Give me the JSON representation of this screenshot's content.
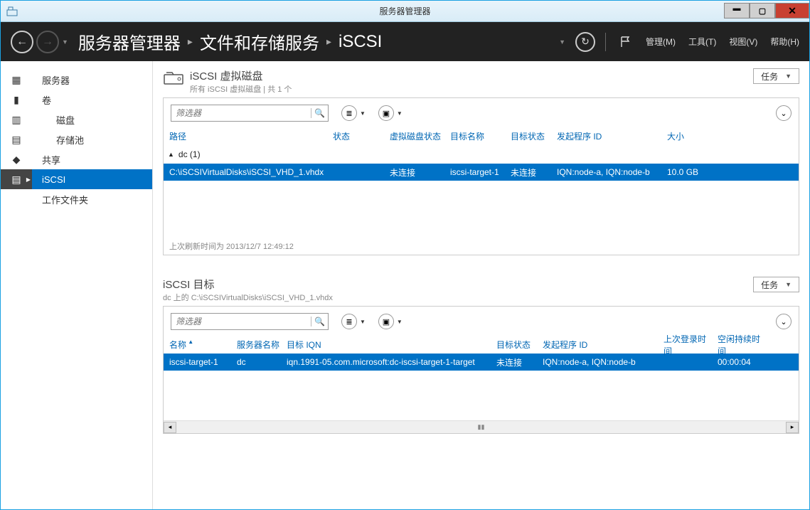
{
  "window": {
    "title": "服务器管理器"
  },
  "header": {
    "crumbs": [
      "服务器管理器",
      "文件和存储服务",
      "iSCSI"
    ],
    "menus": {
      "manage": "管理(M)",
      "tools": "工具(T)",
      "view": "视图(V)",
      "help": "帮助(H)"
    }
  },
  "sidebar": {
    "items": [
      {
        "label": "服务器",
        "sub": false
      },
      {
        "label": "卷",
        "sub": false
      },
      {
        "label": "磁盘",
        "sub": true
      },
      {
        "label": "存储池",
        "sub": true
      },
      {
        "label": "共享",
        "sub": false
      },
      {
        "label": "iSCSI",
        "sub": false,
        "selected": true
      },
      {
        "label": "工作文件夹",
        "sub": false
      }
    ]
  },
  "section1": {
    "title": "iSCSI 虚拟磁盘",
    "subtitle": "所有 iSCSI 虚拟磁盘 | 共 1 个",
    "filter_placeholder": "筛选器",
    "tasks_label": "任务",
    "headers": {
      "path": "路径",
      "status": "状态",
      "vdisk_status": "虚拟磁盘状态",
      "target_name": "目标名称",
      "target_status": "目标状态",
      "initiator_id": "发起程序 ID",
      "size": "大小"
    },
    "group": "dc (1)",
    "row": {
      "path": "C:\\iSCSIVirtualDisks\\iSCSI_VHD_1.vhdx",
      "status": "",
      "vdisk_status": "未连接",
      "target_name": "iscsi-target-1",
      "target_status": "未连接",
      "initiator_id": "IQN:node-a, IQN:node-b",
      "size": "10.0 GB"
    },
    "footer": "上次刷新时间为 2013/12/7 12:49:12"
  },
  "section2": {
    "title": "iSCSI 目标",
    "subtitle": "dc 上的 C:\\iSCSIVirtualDisks\\iSCSI_VHD_1.vhdx",
    "filter_placeholder": "筛选器",
    "tasks_label": "任务",
    "headers": {
      "name": "名称",
      "server_name": "服务器名称",
      "target_iqn": "目标 IQN",
      "target_status": "目标状态",
      "initiator_id": "发起程序 ID",
      "last_login": "上次登录时间",
      "idle": "空闲持续时间"
    },
    "row": {
      "name": "iscsi-target-1",
      "server_name": "dc",
      "target_iqn": "iqn.1991-05.com.microsoft:dc-iscsi-target-1-target",
      "target_status": "未连接",
      "initiator_id": "IQN:node-a, IQN:node-b",
      "last_login": "",
      "idle": "00:00:04"
    }
  }
}
